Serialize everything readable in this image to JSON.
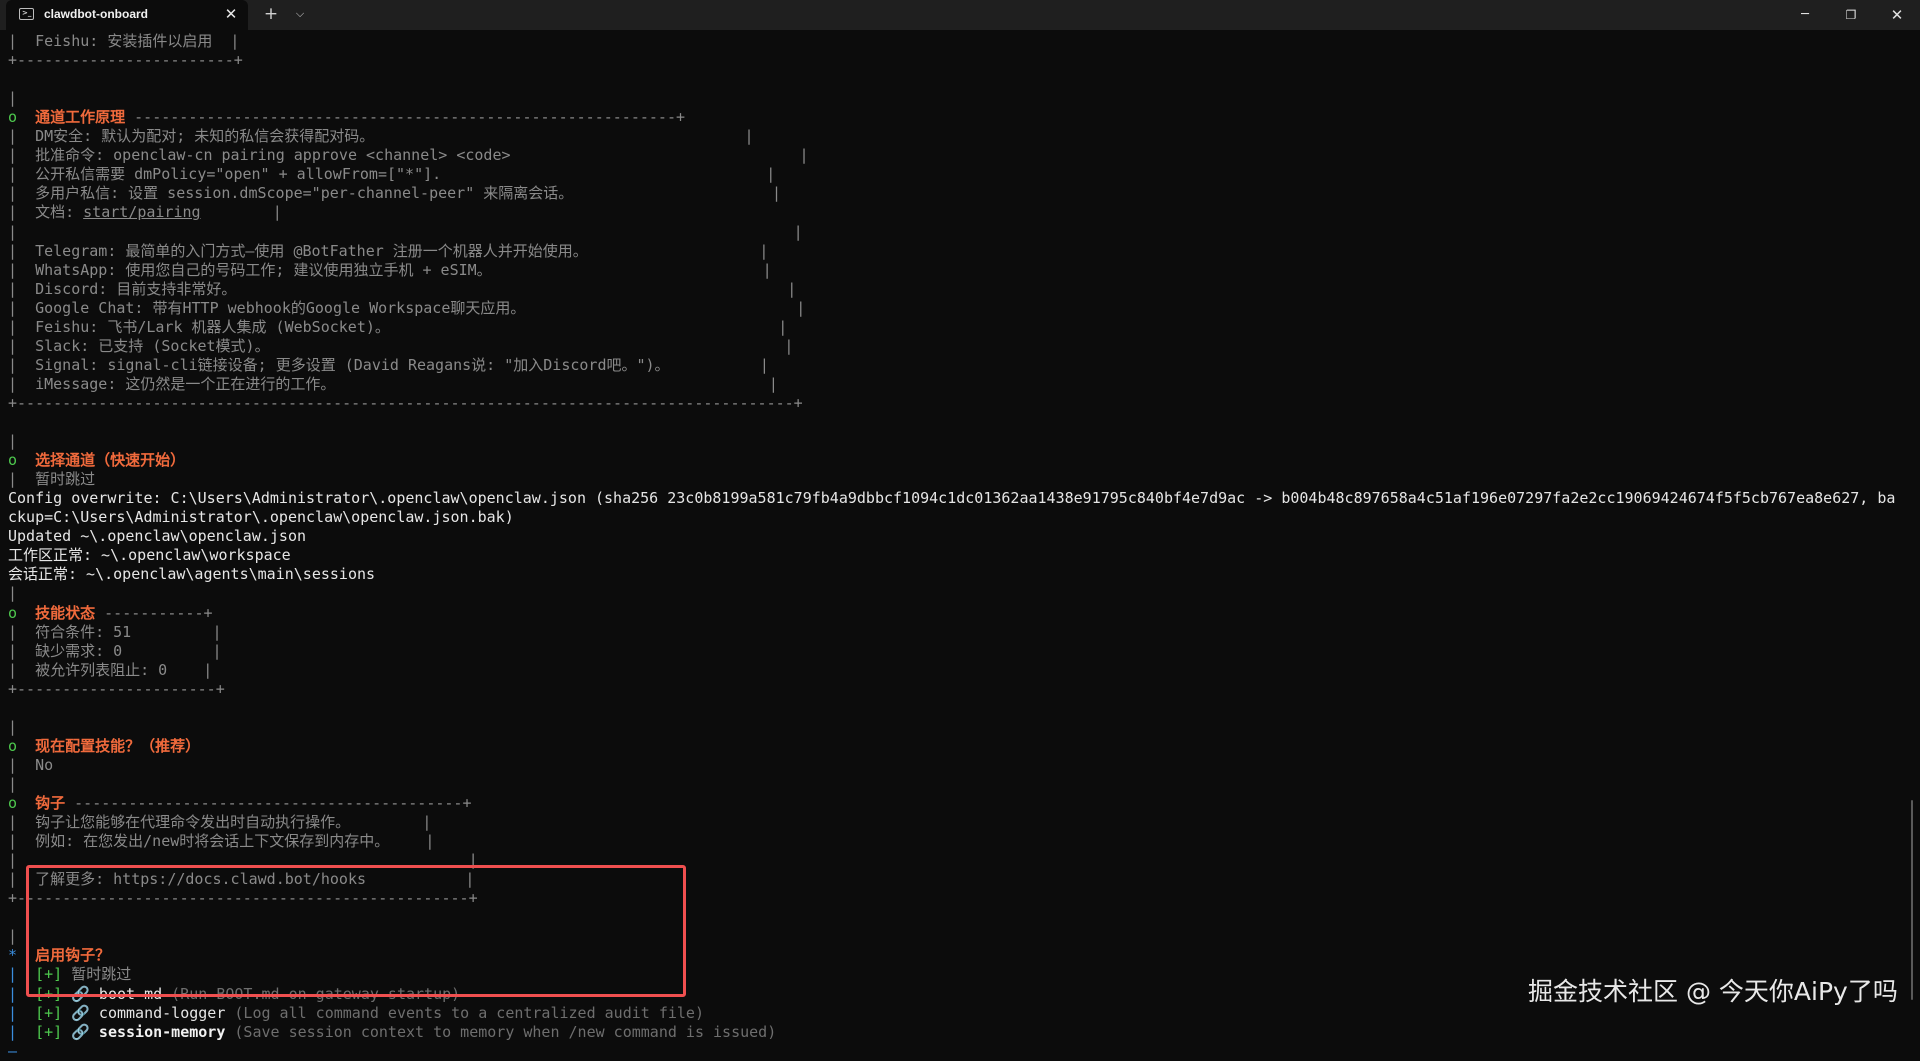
{
  "window": {
    "tab_title": "clawdbot-onboard",
    "tab_icon": "terminal-icon",
    "new_tab_glyph": "+",
    "dropdown_glyph": "⌵",
    "close_glyph": "✕",
    "min_glyph": "─",
    "max_glyph": "❐",
    "win_close_glyph": "✕"
  },
  "terminal": {
    "lines": [
      {
        "cls": "g",
        "text": "|  Feishu: 安装插件以启用  |"
      },
      {
        "cls": "g",
        "text": "+------------------------+"
      },
      {
        "cls": "g",
        "text": ""
      },
      {
        "cls": "g",
        "text": "|"
      },
      {
        "segs": [
          {
            "cls": "gr",
            "text": "o  "
          },
          {
            "cls": "or",
            "text": "通道工作原理"
          },
          {
            "cls": "g",
            "text": " ------------------------------------------------------------+"
          }
        ]
      },
      {
        "cls": "g",
        "text": "|  DM安全: 默认为配对; 未知的私信会获得配对码。                                         |"
      },
      {
        "cls": "g",
        "text": "|  批准命令: openclaw-cn pairing approve <channel> <code>                                |"
      },
      {
        "cls": "g",
        "text": "|  公开私信需要 dmPolicy=\"open\" + allowFrom=[\"*\"].                                    |"
      },
      {
        "cls": "g",
        "text": "|  多用户私信: 设置 session.dmScope=\"per-channel-peer\" 来隔离会话。                      |"
      },
      {
        "segs": [
          {
            "cls": "g",
            "text": "|  文档: "
          },
          {
            "cls": "g u",
            "text": "start/pairing"
          },
          {
            "cls": "g",
            "text": "        |"
          }
        ]
      },
      {
        "cls": "g",
        "text": "|                                                                                      |"
      },
      {
        "cls": "g",
        "text": "|  Telegram: 最简单的入门方式—使用 @BotFather 注册一个机器人并开始使用。                   |"
      },
      {
        "cls": "g",
        "text": "|  WhatsApp: 使用您自己的号码工作; 建议使用独立手机 + eSIM。                              |"
      },
      {
        "cls": "g",
        "text": "|  Discord: 目前支持非常好。                                                             |"
      },
      {
        "cls": "g",
        "text": "|  Google Chat: 带有HTTP webhook的Google Workspace聊天应用。                              |"
      },
      {
        "cls": "g",
        "text": "|  Feishu: 飞书/Lark 机器人集成 (WebSocket)。                                           |"
      },
      {
        "cls": "g",
        "text": "|  Slack: 已支持 (Socket模式)。                                                         |"
      },
      {
        "cls": "g",
        "text": "|  Signal: signal-cli链接设备; 更多设置 (David Reagans说: \"加入Discord吧。\")。          |"
      },
      {
        "cls": "g",
        "text": "|  iMessage: 这仍然是一个正在进行的工作。                                                |"
      },
      {
        "cls": "g",
        "text": "+--------------------------------------------------------------------------------------+"
      },
      {
        "cls": "g",
        "text": ""
      },
      {
        "cls": "g",
        "text": "|"
      },
      {
        "segs": [
          {
            "cls": "gr",
            "text": "o  "
          },
          {
            "cls": "or",
            "text": "选择通道（快速开始）"
          }
        ]
      },
      {
        "cls": "g",
        "text": "|  暂时跳过"
      },
      {
        "cls": "w",
        "text": "Config overwrite: C:\\Users\\Administrator\\.openclaw\\openclaw.json (sha256 23c0b8199a581c79fb4a9dbbcf1094c1dc01362aa1438e91795c840bf4e7d9ac -> b004b48c897658a4c51af196e07297fa2e2cc19069424674f5f5cb767ea8e627, ba"
      },
      {
        "cls": "w",
        "text": "ckup=C:\\Users\\Administrator\\.openclaw\\openclaw.json.bak)"
      },
      {
        "cls": "w",
        "text": "Updated ~\\.openclaw\\openclaw.json"
      },
      {
        "cls": "w",
        "text": "工作区正常: ~\\.openclaw\\workspace"
      },
      {
        "cls": "w",
        "text": "会话正常: ~\\.openclaw\\agents\\main\\sessions"
      },
      {
        "cls": "g",
        "text": "|"
      },
      {
        "segs": [
          {
            "cls": "gr",
            "text": "o  "
          },
          {
            "cls": "or",
            "text": "技能状态"
          },
          {
            "cls": "g",
            "text": " -----------+"
          }
        ]
      },
      {
        "cls": "g",
        "text": "|  符合条件: 51         |"
      },
      {
        "cls": "g",
        "text": "|  缺少需求: 0          |"
      },
      {
        "cls": "g",
        "text": "|  被允许列表阻止: 0    |"
      },
      {
        "cls": "g",
        "text": "+----------------------+"
      },
      {
        "cls": "g",
        "text": ""
      },
      {
        "cls": "g",
        "text": "|"
      },
      {
        "segs": [
          {
            "cls": "gr",
            "text": "o  "
          },
          {
            "cls": "or",
            "text": "现在配置技能？（推荐）"
          }
        ]
      },
      {
        "cls": "g",
        "text": "|  No"
      },
      {
        "cls": "g",
        "text": "|"
      },
      {
        "segs": [
          {
            "cls": "gr",
            "text": "o  "
          },
          {
            "cls": "or",
            "text": "钩子"
          },
          {
            "cls": "g",
            "text": " -------------------------------------------+"
          }
        ]
      },
      {
        "cls": "g",
        "text": "|  钩子让您能够在代理命令发出时自动执行操作。        |"
      },
      {
        "cls": "g",
        "text": "|  例如: 在您发出/new时将会话上下文保存到内存中。    |"
      },
      {
        "cls": "g",
        "text": "|                                                  |"
      },
      {
        "cls": "g",
        "text": "|  了解更多: https://docs.clawd.bot/hooks           |"
      },
      {
        "cls": "g",
        "text": "+--------------------------------------------------+"
      },
      {
        "cls": "g",
        "text": ""
      },
      {
        "cls": "g",
        "text": "|"
      },
      {
        "segs": [
          {
            "cls": "cy",
            "text": "*  "
          },
          {
            "cls": "or",
            "text": "启用钩子？"
          }
        ]
      },
      {
        "segs": [
          {
            "cls": "cy",
            "text": "|  "
          },
          {
            "cls": "gr",
            "text": "[+]"
          },
          {
            "cls": "g",
            "text": " 暂时跳过"
          }
        ]
      },
      {
        "segs": [
          {
            "cls": "cy",
            "text": "|  "
          },
          {
            "cls": "gr",
            "text": "[+]"
          },
          {
            "cls": "w",
            "text": " 🔗 boot-md "
          },
          {
            "cls": "dim",
            "text": "(Run BOOT.md on gateway startup)"
          }
        ]
      },
      {
        "segs": [
          {
            "cls": "cy",
            "text": "|  "
          },
          {
            "cls": "gr",
            "text": "[+]"
          },
          {
            "cls": "w",
            "text": " 🔗 command-logger "
          },
          {
            "cls": "dim",
            "text": "(Log all command events to a centralized audit file)"
          }
        ]
      },
      {
        "segs": [
          {
            "cls": "cy",
            "text": "|  "
          },
          {
            "cls": "gr",
            "text": "[+]"
          },
          {
            "cls": "wb",
            "text": " 🔗 session-memory "
          },
          {
            "cls": "dim",
            "text": "(Save session context to memory when /new command is issued)"
          }
        ]
      },
      {
        "cls": "cy",
        "text": "—"
      }
    ]
  },
  "watermark": "掘金技术社区 @ 今天你AiPy了吗"
}
